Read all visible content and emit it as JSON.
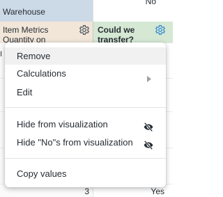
{
  "table": {
    "warehouse_header": "Warehouse",
    "no_header": "No",
    "metric_header": "Item Metrics Quantity on",
    "transfer_header": "Could we transfer?",
    "left_cut_text": "I",
    "bottom_number": "3",
    "bottom_value": "Yes"
  },
  "menu": {
    "remove": "Remove",
    "calculations": "Calculations",
    "edit": "Edit",
    "hide_from_viz": "Hide from visualization",
    "hide_nos": "Hide \"No\"s from visualization",
    "copy_values": "Copy values"
  },
  "icons": {
    "gear": "gear-icon",
    "eye_off": "eye-off-icon",
    "chevron": "chevron-right-icon"
  },
  "colors": {
    "dimension_header": "#ccd9e6",
    "measure_header": "#f2e6d9",
    "calc_header": "#d5e8d4",
    "gear_blue": "#3d8ecf"
  }
}
